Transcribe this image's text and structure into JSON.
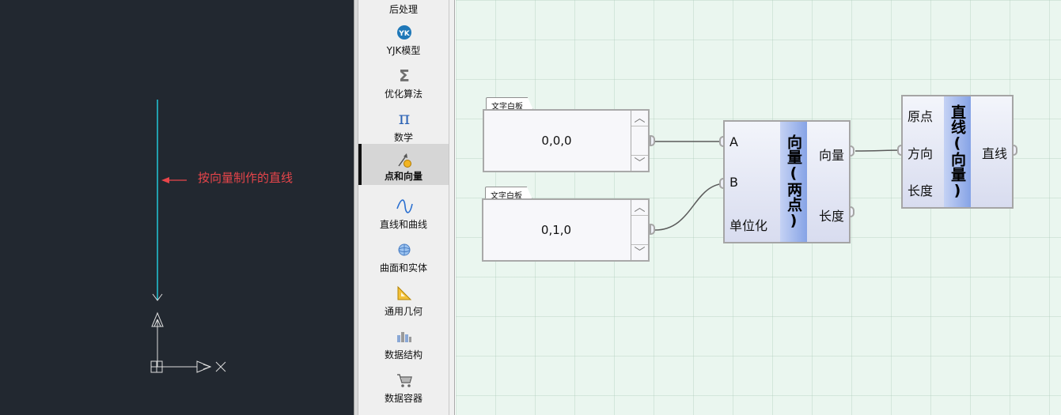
{
  "cad": {
    "annotation": "按向量制作的直线",
    "line_color": "#22c7d8",
    "arrow_color": "#e8454a"
  },
  "palette": {
    "items": [
      {
        "label": "后处理",
        "icon": "postprocess-icon",
        "active": false
      },
      {
        "label": "YJK模型",
        "icon": "yjk-logo-icon",
        "active": false
      },
      {
        "label": "优化算法",
        "icon": "sigma-icon",
        "active": false
      },
      {
        "label": "数学",
        "icon": "pi-icon",
        "active": false
      },
      {
        "label": "点和向量",
        "icon": "point-vector-icon",
        "active": true
      },
      {
        "label": "直线和曲线",
        "icon": "curve-icon",
        "active": false
      },
      {
        "label": "曲面和实体",
        "icon": "surface-icon",
        "active": false
      },
      {
        "label": "通用几何",
        "icon": "triangle-ruler-icon",
        "active": false
      },
      {
        "label": "数据结构",
        "icon": "data-structure-icon",
        "active": false
      },
      {
        "label": "数据容器",
        "icon": "cart-icon",
        "active": false
      }
    ]
  },
  "canvas": {
    "panel1": {
      "tab": "文字白板",
      "value": "0,0,0"
    },
    "panel2": {
      "tab": "文字白板",
      "value": "0,1,0"
    },
    "vector_node": {
      "title": "向量(两点)",
      "inputs": [
        "A",
        "B",
        "单位化"
      ],
      "outputs": [
        "向量",
        "长度"
      ]
    },
    "line_node": {
      "title": "直线(向量)",
      "inputs": [
        "原点",
        "方向",
        "长度"
      ],
      "outputs": [
        "直线"
      ]
    },
    "colors": {
      "node_band": "#86a3e6",
      "wire": "#5a5a5a"
    }
  }
}
